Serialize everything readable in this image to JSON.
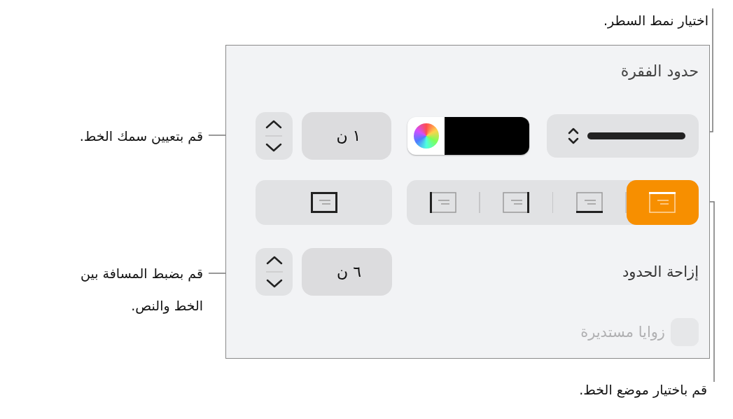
{
  "callouts": [
    {
      "text": "اختيار نمط السطر."
    },
    {
      "text": "قم بتعيين سمك الخط."
    },
    {
      "text": "قم بضبط المسافة بين الخط والنص."
    },
    {
      "text": "قم باختيار موضع الخط."
    }
  ],
  "panel": {
    "title": "حدود الفقرة",
    "line_style": {
      "kind": "solid"
    },
    "color_well": {
      "color": "#000000"
    },
    "thickness": {
      "value": "١ ن"
    },
    "position_segments": [
      {
        "kind": "top",
        "selected": true
      },
      {
        "kind": "bottom",
        "selected": false
      },
      {
        "kind": "right",
        "selected": false
      },
      {
        "kind": "left",
        "selected": false
      }
    ],
    "border_button": {
      "kind": "all"
    },
    "offset": {
      "label": "إزاحة الحدود",
      "value": "٦ ن"
    },
    "rounded_corners": {
      "label": "زوايا مستديرة",
      "checked": false,
      "disabled": true
    }
  }
}
